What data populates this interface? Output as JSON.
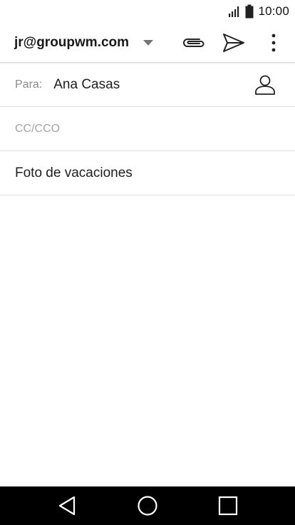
{
  "status_bar": {
    "time": "10:00",
    "icons": [
      "signal-icon",
      "battery-icon"
    ]
  },
  "toolbar": {
    "account_email": "jr@groupwm.com",
    "icons": [
      "dropdown-caret-icon",
      "attach-icon",
      "send-icon",
      "more-vert-icon"
    ]
  },
  "compose": {
    "to_label": "Para:",
    "to_value": "Ana Casas",
    "cc_placeholder": "CC/CCO",
    "subject": "Foto de vacaciones",
    "body": ""
  },
  "nav_bar": {
    "icons": [
      "back-icon",
      "home-icon",
      "recents-icon"
    ]
  },
  "colors": {
    "text": "#212121",
    "label": "#8a8a8a",
    "placeholder": "#a4a4a4",
    "divider": "#e0e0e0",
    "nav_background": "#000000"
  }
}
